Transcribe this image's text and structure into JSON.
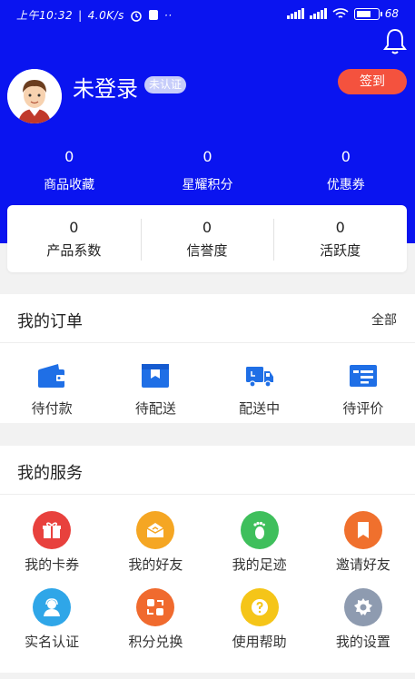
{
  "status_bar": {
    "time": "上午10:32",
    "speed": "4.0K/s",
    "network": "HD",
    "battery": "68",
    "battery_level": 0.68
  },
  "profile": {
    "username": "未登录",
    "badge": "未认证",
    "checkin_label": "签到"
  },
  "header_stats": [
    {
      "value": "0",
      "label": "商品收藏"
    },
    {
      "value": "0",
      "label": "星耀积分"
    },
    {
      "value": "0",
      "label": "优惠券"
    }
  ],
  "card_stats": [
    {
      "value": "0",
      "label": "产品系数"
    },
    {
      "value": "0",
      "label": "信誉度"
    },
    {
      "value": "0",
      "label": "活跃度"
    }
  ],
  "orders": {
    "title": "我的订单",
    "more": "全部",
    "items": [
      {
        "label": "待付款",
        "icon": "wallet-icon"
      },
      {
        "label": "待配送",
        "icon": "package-icon"
      },
      {
        "label": "配送中",
        "icon": "truck-icon"
      },
      {
        "label": "待评价",
        "icon": "review-icon"
      }
    ]
  },
  "services": {
    "title": "我的服务",
    "items": [
      {
        "label": "我的卡券",
        "icon": "gift-icon",
        "color": "#e8413d"
      },
      {
        "label": "我的好友",
        "icon": "friends-icon",
        "color": "#f5a623"
      },
      {
        "label": "我的足迹",
        "icon": "footprint-icon",
        "color": "#3fbf5c"
      },
      {
        "label": "邀请好友",
        "icon": "invite-icon",
        "color": "#f0702d"
      },
      {
        "label": "实名认证",
        "icon": "verify-icon",
        "color": "#2fa6e8"
      },
      {
        "label": "积分兑换",
        "icon": "exchange-icon",
        "color": "#f06a2e"
      },
      {
        "label": "使用帮助",
        "icon": "help-icon",
        "color": "#f5c518"
      },
      {
        "label": "我的设置",
        "icon": "settings-icon",
        "color": "#8e9bb0"
      }
    ]
  },
  "colors": {
    "header_bg": "#0a14f0",
    "accent_icon": "#1f6fe6",
    "checkin_bg": "#f4523e"
  }
}
